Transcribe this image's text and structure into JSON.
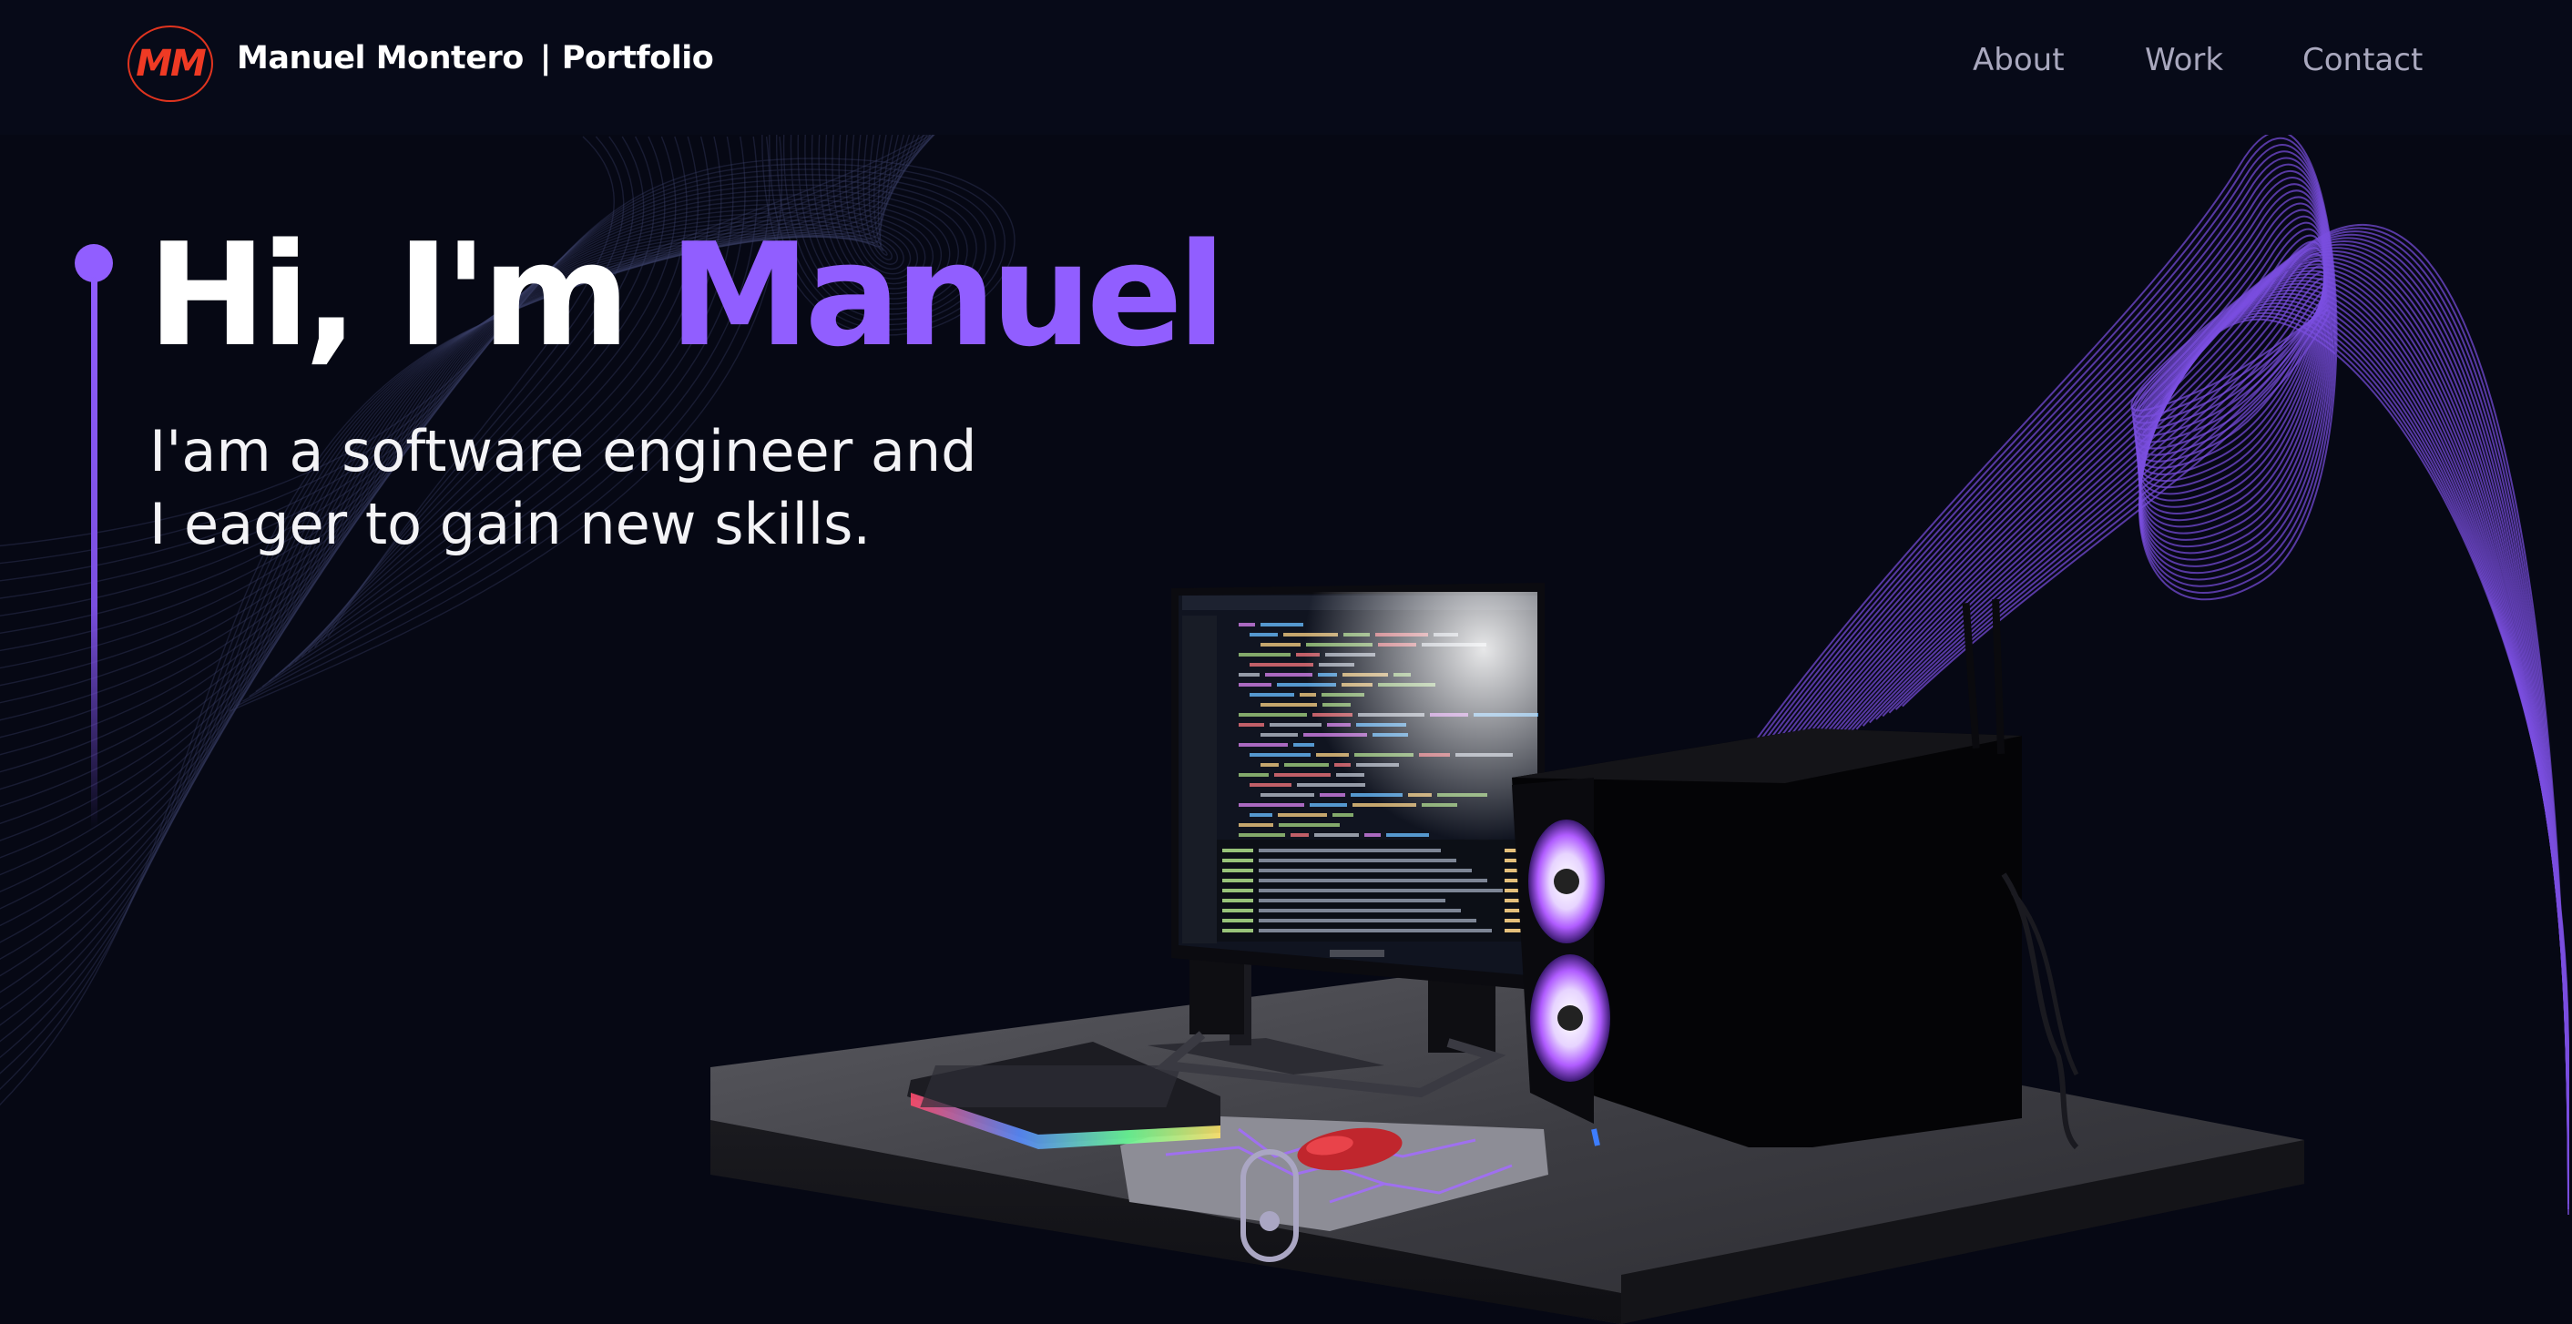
{
  "header": {
    "logo_text": "MM",
    "brand_name": "Manuel Montero",
    "brand_suffix": "| Portfolio",
    "nav": [
      {
        "label": "About"
      },
      {
        "label": "Work"
      },
      {
        "label": "Contact"
      }
    ]
  },
  "hero": {
    "greeting": "Hi, I'm ",
    "name": "Manuel",
    "subtitle_line1": "I'am a software engineer and",
    "subtitle_line2": "I eager to gain new skills."
  },
  "colors": {
    "accent": "#915eff",
    "logo_red": "#ef3a24",
    "background": "#060814",
    "nav_text": "#a9a8be"
  },
  "icons": {
    "scroll": "mouse-scroll-icon"
  }
}
